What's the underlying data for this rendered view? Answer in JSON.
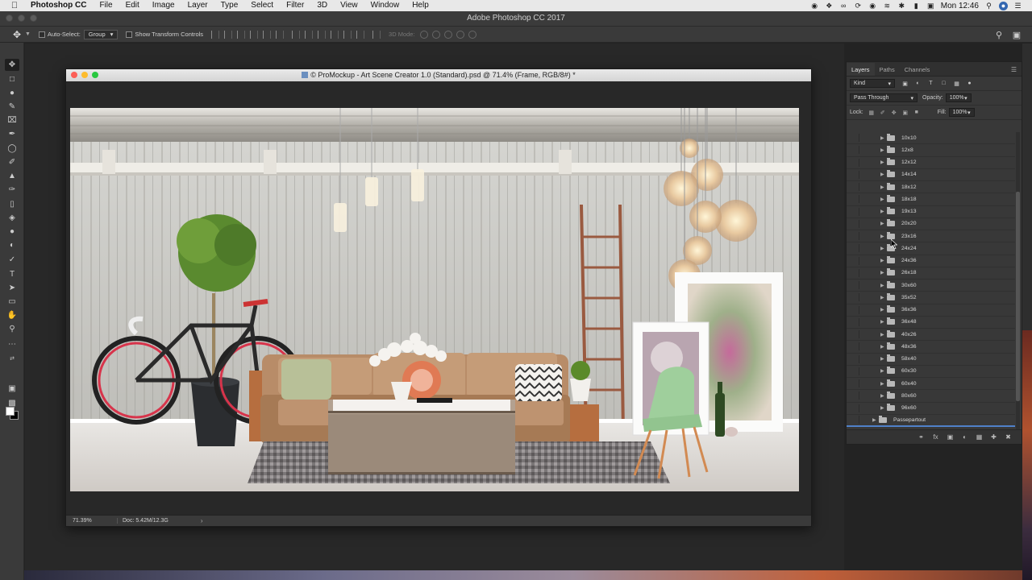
{
  "menubar": {
    "app_name": "Photoshop CC",
    "items": [
      "File",
      "Edit",
      "Image",
      "Layer",
      "Type",
      "Select",
      "Filter",
      "3D",
      "View",
      "Window",
      "Help"
    ],
    "clock": "Mon 12:46"
  },
  "window": {
    "title": "Adobe Photoshop CC 2017"
  },
  "options_bar": {
    "auto_select_label": "Auto-Select:",
    "auto_select_value": "Group",
    "show_transform_label": "Show Transform Controls",
    "mode_3d_label": "3D Mode:"
  },
  "document": {
    "title": "© ProMockup - Art Scene Creator 1.0 (Standard).psd @ 71.4% (Frame, RGB/8#) *",
    "zoom": "71.39%",
    "doc_size": "Doc: 5.42M/12.3G"
  },
  "layers_panel": {
    "tabs": [
      "Layers",
      "Paths",
      "Channels"
    ],
    "active_tab": "Layers",
    "filter_kind": "Kind",
    "blend_mode": "Pass Through",
    "opacity_label": "Opacity:",
    "opacity_value": "100%",
    "lock_label": "Lock:",
    "fill_label": "Fill:",
    "fill_value": "100%",
    "groups": [
      "10x10",
      "12x8",
      "12x12",
      "14x14",
      "18x12",
      "18x18",
      "19x13",
      "20x20",
      "23x16",
      "24x24",
      "24x36",
      "26x18",
      "30x60",
      "35x52",
      "36x36",
      "36x48",
      "40x26",
      "48x36",
      "58x40",
      "60x30",
      "60x40",
      "80x60",
      "96x60"
    ],
    "parent_group": "Passepartout"
  },
  "colors": {
    "accent": "#4f80c9",
    "panel": "#383838",
    "workspace": "#282828"
  },
  "icons": {
    "apple": "apple-icon",
    "move_tool": "move-tool-icon",
    "search": "search-icon",
    "folder": "folder-icon"
  }
}
